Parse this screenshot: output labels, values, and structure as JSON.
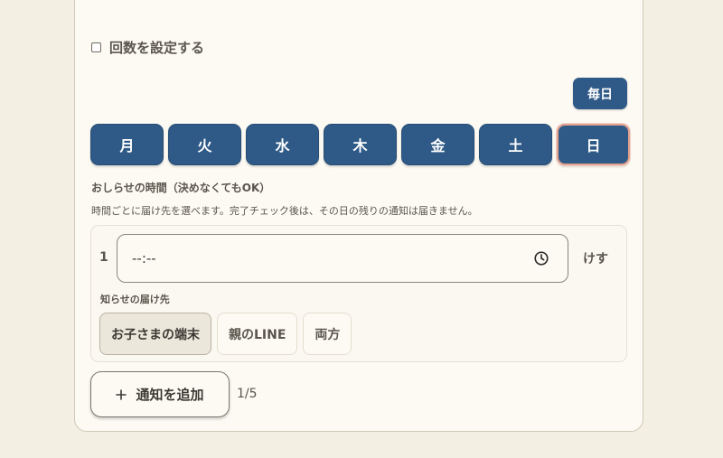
{
  "count_setting": {
    "label": "回数を設定する",
    "checked": false
  },
  "schedule": {
    "everyday_label": "毎日",
    "days": [
      {
        "label": "月",
        "selected": false
      },
      {
        "label": "火",
        "selected": false
      },
      {
        "label": "水",
        "selected": false
      },
      {
        "label": "木",
        "selected": false
      },
      {
        "label": "金",
        "selected": false
      },
      {
        "label": "土",
        "selected": false
      },
      {
        "label": "日",
        "selected": true
      }
    ]
  },
  "notification_time": {
    "title": "おしらせの時間（決めなくてもOK）",
    "description": "時間ごとに届け先を選べます。完了チェック後は、その日の残りの通知は届きません。",
    "rows": [
      {
        "index": "1",
        "time_value": "--:--",
        "delete_label": "けす",
        "destination_label": "知らせの届け先",
        "destinations": [
          {
            "label": "お子さまの端末",
            "active": true
          },
          {
            "label": "親のLINE",
            "active": false
          },
          {
            "label": "両方",
            "active": false
          }
        ]
      }
    ]
  },
  "add_button": {
    "icon": "plus-icon",
    "label": "通知を追加"
  },
  "counter": "1/5",
  "colors": {
    "primary": "#2f5a87",
    "selected_outline": "#e3a28f",
    "background": "#f3efe3",
    "card": "#fcfaf3"
  }
}
